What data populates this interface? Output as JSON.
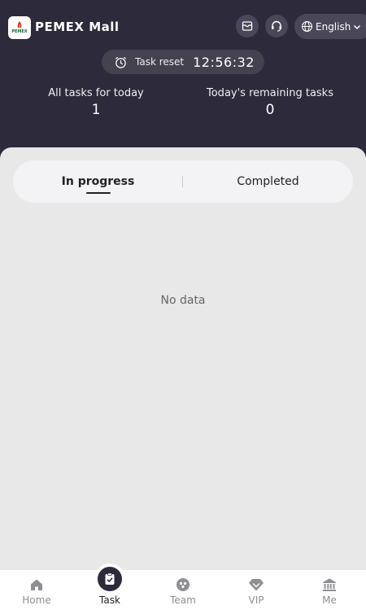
{
  "header": {
    "app_title": "PEMEX Mall",
    "logo_text": "PEMEX",
    "language": "English",
    "icons": [
      "mail-icon",
      "headset-icon",
      "globe-icon",
      "chevron-down-icon"
    ]
  },
  "task_reset": {
    "label": "Task reset",
    "time": "12:56:32"
  },
  "stats": {
    "all_tasks_label": "All tasks for today",
    "all_tasks_value": "1",
    "remaining_label": "Today's remaining tasks",
    "remaining_value": "0"
  },
  "tabs": {
    "in_progress": "In progress",
    "completed": "Completed",
    "active": "in_progress"
  },
  "empty_state": "No data",
  "bottom_nav": {
    "home": "Home",
    "task": "Task",
    "team": "Team",
    "vip": "VIP",
    "me": "Me",
    "active": "task"
  },
  "colors": {
    "header_bg": "#2c2a3b",
    "content_bg": "#e8e8e8",
    "inactive_nav": "#8e8e93"
  }
}
